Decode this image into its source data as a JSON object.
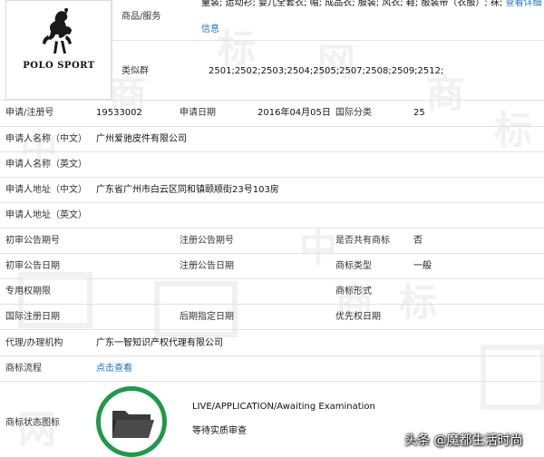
{
  "brand": {
    "logo_text": "POLO SPORT"
  },
  "goods": {
    "label": "商品/服务",
    "text": "童装; 运动衫; 婴儿全套衣; 帽; 成品衣; 服装; 风衣; 鞋; 服装带（衣服）; 袜;",
    "more_link": "查看详细信息",
    "more_link_line1": "查看详细",
    "more_link_line2": "信息"
  },
  "similar_groups": {
    "label": "类似群",
    "value": "2501;2502;2503;2504;2505;2507;2508;2509;2512;"
  },
  "registration": {
    "number_label": "申请/注册号",
    "number_value": "19533002",
    "date_label": "申请日期",
    "date_value": "2016年04月05日",
    "class_label": "国际分类",
    "class_value": "25"
  },
  "applicant": {
    "name_cn_label": "申请人名称（中文）",
    "name_cn_value": "广州爱驰皮件有限公司",
    "name_en_label": "申请人名称（英文）",
    "addr_cn_label": "申请人地址（中文）",
    "addr_cn_value": "广东省广州市白云区同和镇颐顺街23号103房",
    "addr_en_label": "申请人地址（英文）"
  },
  "announcements": {
    "prelim_no_label": "初审公告期号",
    "reg_no_label": "注册公告期号",
    "shared_label": "是否共有商标",
    "shared_value": "否",
    "prelim_date_label": "初审公告日期",
    "reg_date_label": "注册公告日期",
    "type_label": "商标类型",
    "type_value": "一般",
    "exclusive_label": "专用权期限",
    "form_label": "商标形式",
    "intl_date_label": "国际注册日期",
    "later_date_label": "后期指定日期",
    "priority_date_label": "优先权日期"
  },
  "agent": {
    "label": "代理/办理机构",
    "value": "广东一智知识产权代理有限公司"
  },
  "process": {
    "label": "商标流程",
    "link": "点击查看"
  },
  "status": {
    "label": "商标状态图标",
    "en_text": "LIVE/APPLICATION/Awaiting Examination",
    "cn_text": "等待实质审查"
  },
  "footer": {
    "watermark": "头条 @魔都生活时尚"
  },
  "colors": {
    "link": "#1a73c8",
    "status_ring": "#1e9a49",
    "folder": "#3a3a3a"
  },
  "watermarks": [
    "中",
    "商",
    "标",
    "网",
    "商",
    "标",
    "中",
    "商",
    "标",
    "网"
  ]
}
